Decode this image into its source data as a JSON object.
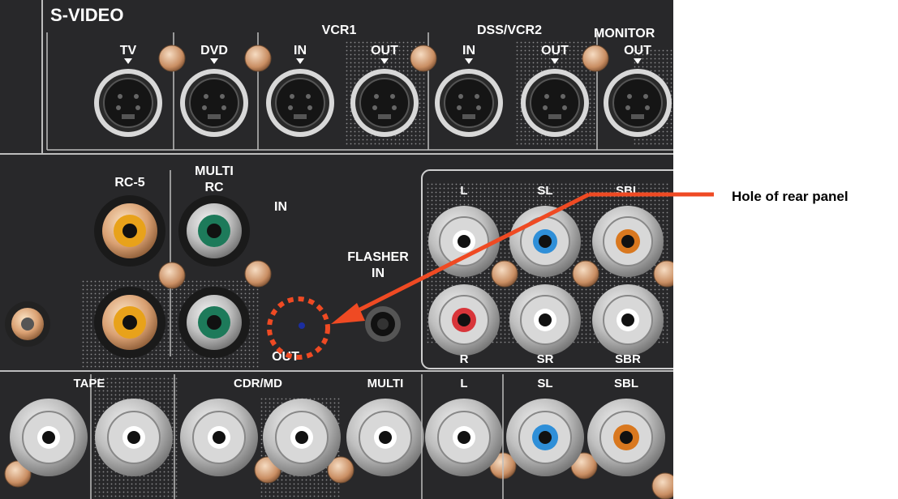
{
  "callout": {
    "label": "Hole of rear panel",
    "color": "#ef4a23"
  },
  "panel": {
    "s_video": {
      "title": "S-VIDEO",
      "labels": {
        "tv": "TV",
        "dvd": "DVD",
        "vcr1": "VCR1",
        "vcr1_in": "IN",
        "vcr1_out": "OUT",
        "dss_vcr2": "DSS/VCR2",
        "dss_in": "IN",
        "dss_out": "OUT",
        "monitor": "MONITOR",
        "monitor_out": "OUT"
      }
    },
    "middle": {
      "rc5": "RC-5",
      "multi": "MULTI",
      "rc": "RC",
      "in": "IN",
      "flasher": "FLASHER",
      "flasher_in": "IN",
      "out": "OUT"
    },
    "preout": {
      "l": "L",
      "sl": "SL",
      "sbl": "SBL",
      "r": "R",
      "sr": "SR",
      "sbr": "SBR"
    },
    "bottom": {
      "tape": "TAPE",
      "cdr_md": "CDR/MD",
      "multi": "MULTI",
      "l": "L",
      "sl": "SL",
      "sbl": "SBL"
    }
  },
  "colors": {
    "panel": "#2b2b2d",
    "rca_yellow": "#e8a21a",
    "rca_green": "#1d7a5a",
    "rca_blue": "#2f8fd8",
    "rca_orange": "#d9781f",
    "rca_red": "#d8353a"
  }
}
